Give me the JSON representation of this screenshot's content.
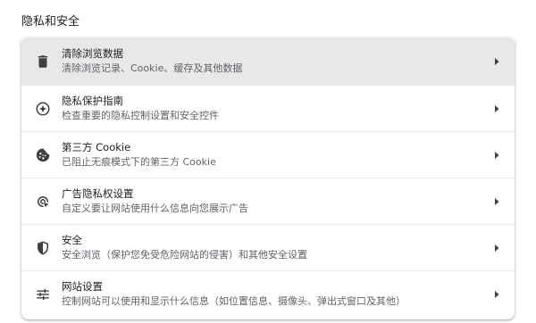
{
  "section": {
    "title": "隐私和安全"
  },
  "items": [
    {
      "label": "清除浏览数据",
      "sublabel": "清除浏览记录、Cookie、缓存及其他数据",
      "icon": "trash-icon",
      "active": true
    },
    {
      "label": "隐私保护指南",
      "sublabel": "检查重要的隐私控制设置和安全控件",
      "icon": "compass-icon",
      "active": false
    },
    {
      "label": "第三方 Cookie",
      "sublabel": "已阻止无痕模式下的第三方 Cookie",
      "icon": "cookie-icon",
      "active": false
    },
    {
      "label": "广告隐私权设置",
      "sublabel": "自定义要让网站使用什么信息向您展示广告",
      "icon": "ad-privacy-icon",
      "active": false
    },
    {
      "label": "安全",
      "sublabel": "安全浏览（保护您免受危险网站的侵害）和其他安全设置",
      "icon": "shield-icon",
      "active": false
    },
    {
      "label": "网站设置",
      "sublabel": "控制网站可以使用和显示什么信息（如位置信息、摄像头、弹出式窗口及其他）",
      "icon": "sliders-icon",
      "active": false
    }
  ],
  "colors": {
    "active_background": "#e8e8e8",
    "icon": "#3c4043",
    "secondary_text": "#5f6368"
  }
}
